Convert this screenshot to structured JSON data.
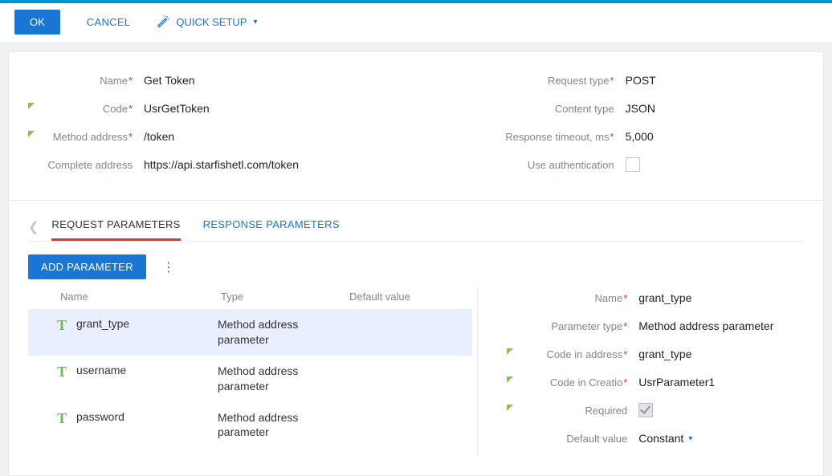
{
  "toolbar": {
    "ok": "OK",
    "cancel": "CANCEL",
    "quick_setup": "QUICK SETUP"
  },
  "form": {
    "labels": {
      "name": "Name",
      "code": "Code",
      "method_address": "Method address",
      "complete_address": "Complete address",
      "request_type": "Request type",
      "content_type": "Content type",
      "response_timeout": "Response timeout, ms",
      "use_auth": "Use authentication"
    },
    "values": {
      "name": "Get Token",
      "code": "UsrGetToken",
      "method_address": "/token",
      "complete_address": "https://api.starfishetl.com/token",
      "request_type": "POST",
      "content_type": "JSON",
      "response_timeout": "5,000",
      "use_auth": false
    }
  },
  "tabs": {
    "request": "REQUEST PARAMETERS",
    "response": "RESPONSE PARAMETERS"
  },
  "add_param": "ADD PARAMETER",
  "param_headers": {
    "name": "Name",
    "type": "Type",
    "default": "Default value"
  },
  "params": [
    {
      "name": "grant_type",
      "type": "Method address parameter",
      "default": "",
      "selected": true
    },
    {
      "name": "username",
      "type": "Method address parameter",
      "default": "",
      "selected": false
    },
    {
      "name": "password",
      "type": "Method address parameter",
      "default": "",
      "selected": false
    }
  ],
  "detail": {
    "labels": {
      "name": "Name",
      "param_type": "Parameter type",
      "code_in_address": "Code in address",
      "code_in_creatio": "Code in Creatio",
      "required": "Required",
      "default_value": "Default value"
    },
    "values": {
      "name": "grant_type",
      "param_type": "Method address parameter",
      "code_in_address": "grant_type",
      "code_in_creatio": "UsrParameter1",
      "required": true,
      "default_value": "Constant"
    }
  }
}
